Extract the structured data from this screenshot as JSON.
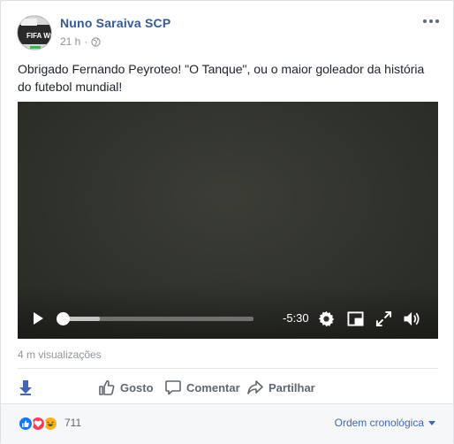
{
  "post": {
    "author": "Nuno Saraiva SCP",
    "timestamp": "21 h",
    "separator": "·",
    "privacy_icon": "globe-icon",
    "text": "Obrigado Fernando Peyroteo! \"O Tanque\", ou o maior goleador da história do futebol mundial!",
    "avatar_text": "FIFA WO"
  },
  "video": {
    "remaining_time": "-5:30",
    "playback_progress": 0.0,
    "buffered_progress": 0.2,
    "controls": [
      "play-icon",
      "settings-icon",
      "picture-in-picture-icon",
      "fullscreen-icon",
      "volume-icon"
    ]
  },
  "stats": {
    "views": "4 m visualizações"
  },
  "actions": {
    "like": "Gosto",
    "comment": "Comentar",
    "share": "Partilhar"
  },
  "reactions": {
    "icons": [
      "like-reaction-icon",
      "love-reaction-icon",
      "haha-reaction-icon"
    ],
    "count": "711"
  },
  "sort": {
    "label": "Ordem cronológica"
  },
  "colors": {
    "brand": "#365899",
    "link": "#4267b2",
    "like": "#1877f2",
    "love": "#f33e58",
    "haha": "#f7b125"
  }
}
